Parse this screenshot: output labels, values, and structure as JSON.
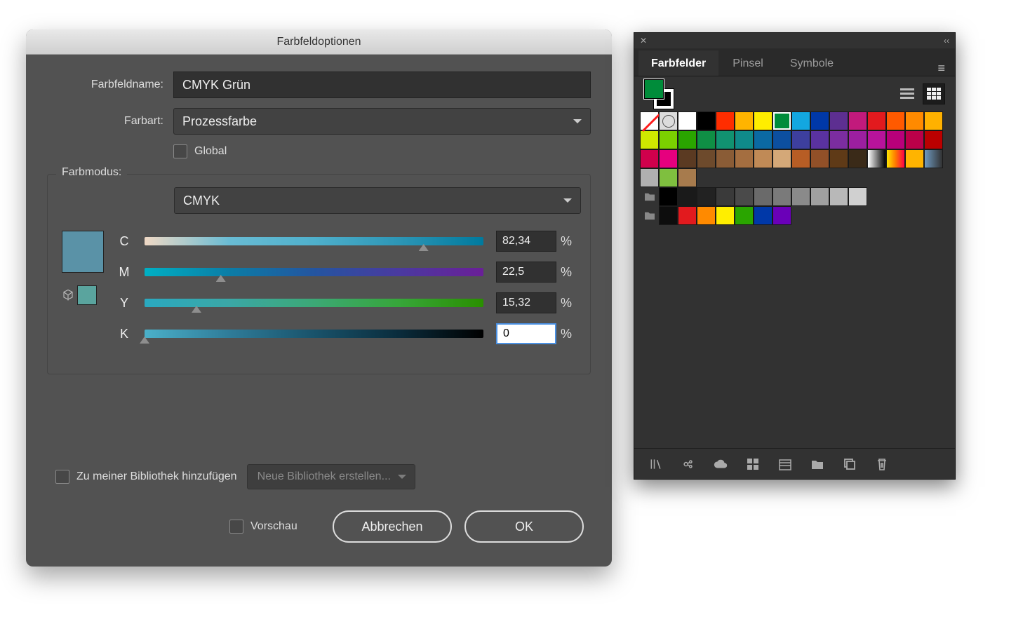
{
  "dialog": {
    "title": "Farbfeldoptionen",
    "labels": {
      "name": "Farbfeldname:",
      "type": "Farbart:",
      "global": "Global",
      "mode": "Farbmodus:",
      "library": "Zu meiner Bibliothek hinzufügen",
      "librarySelect": "Neue Bibliothek erstellen...",
      "preview": "Vorschau",
      "cancel": "Abbrechen",
      "ok": "OK"
    },
    "values": {
      "name": "CMYK Grün",
      "type": "Prozessfarbe",
      "mode": "CMYK"
    },
    "channels": {
      "C": {
        "value": "82,34",
        "pos": 82.34
      },
      "M": {
        "value": "22,5",
        "pos": 22.5
      },
      "Y": {
        "value": "15,32",
        "pos": 15.32
      },
      "K": {
        "value": "0",
        "pos": 0
      }
    },
    "previewColor": "#5a92a7",
    "smallPreview": "#5aa49e"
  },
  "panel": {
    "tabs": [
      "Farbfelder",
      "Pinsel",
      "Symbole"
    ],
    "activeTab": 0,
    "swatches": {
      "row1": [
        "none",
        "reg",
        "#ffffff",
        "#000000",
        "#ff2d00",
        "#ffb400",
        "#ffee00",
        "#008c3a",
        "#13a7e0",
        "#0038a8",
        "#5d2f91",
        "#c21a7c",
        "#e21a1e",
        "#ff5a00",
        "#ff8a00",
        "#ffb100"
      ],
      "row2": [
        "#cfe800",
        "#7bd100",
        "#2aa500",
        "#0f8f45",
        "#119271",
        "#0f8a8a",
        "#0b69a3",
        "#0c4fa0",
        "#3d3f9e",
        "#5a32a0",
        "#7b2da0",
        "#9c1fa0",
        "#b8139b",
        "#b8007a",
        "#bb0049",
        "#bb0000"
      ],
      "row3": [
        "#d0004c",
        "#e6007e",
        "#5b3a22",
        "#6d4a2c",
        "#8a5c36",
        "#a46e40",
        "#c08a56",
        "#d4a878",
        "#b75d25",
        "#925028",
        "#5f3a17",
        "#3a2a18",
        "grad-bw",
        "grad-rb",
        "#ffb400",
        "fade"
      ],
      "row4": [
        "#b0b0b0",
        "#7fbf3f",
        "#a77b4d"
      ],
      "row5": [
        "#000000",
        "#1a1a1a",
        "#222222",
        "#3a3a3a",
        "#4a4a4a",
        "#6a6a6a",
        "#7a7a7a",
        "#8a8a8a",
        "#a0a0a0",
        "#b8b8b8",
        "#d0d0d0"
      ],
      "row6": [
        "#0d0d0d",
        "#e21a1e",
        "#ff8a00",
        "#ffee00",
        "#2aa500",
        "#0038a8",
        "#6a00b8"
      ]
    },
    "selectedSwatch": "#008c3a"
  }
}
